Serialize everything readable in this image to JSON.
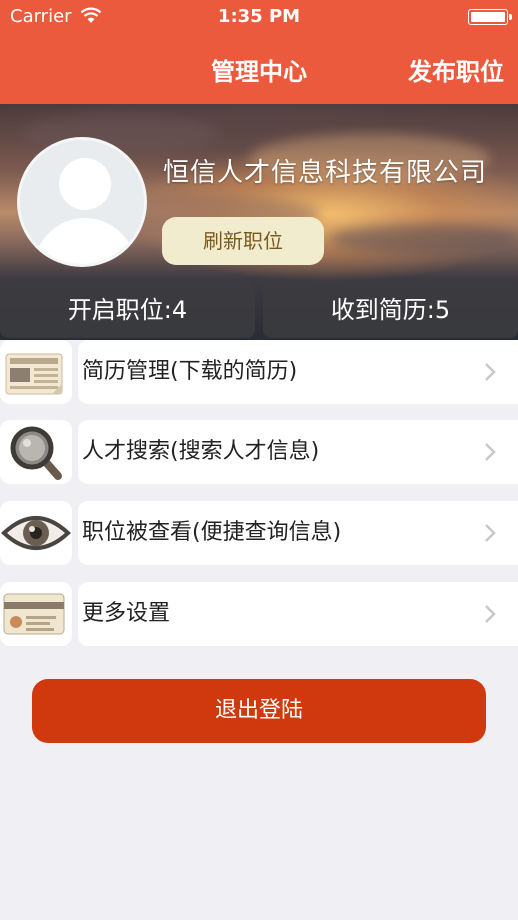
{
  "status_bar": {
    "carrier": "Carrier",
    "time": "1:35 PM"
  },
  "nav": {
    "title": "管理中心",
    "publish_label": "发布职位"
  },
  "profile": {
    "company_name": "恒信人才信息科技有限公司",
    "refresh_label": "刷新职位"
  },
  "stats": {
    "open_positions": "开启职位:4",
    "resumes_received": "收到简历:5"
  },
  "menu": [
    {
      "label": "简历管理(下载的简历)",
      "icon": "newspaper-icon"
    },
    {
      "label": "人才搜索(搜索人才信息)",
      "icon": "magnifier-icon"
    },
    {
      "label": "职位被查看(便捷查询信息)",
      "icon": "eye-icon"
    },
    {
      "label": "更多设置",
      "icon": "id-card-icon"
    }
  ],
  "logout_label": "退出登陆",
  "colors": {
    "brand": "#ec5a3e",
    "logout": "#d0380e",
    "refresh_bg": "#f2eccf"
  }
}
